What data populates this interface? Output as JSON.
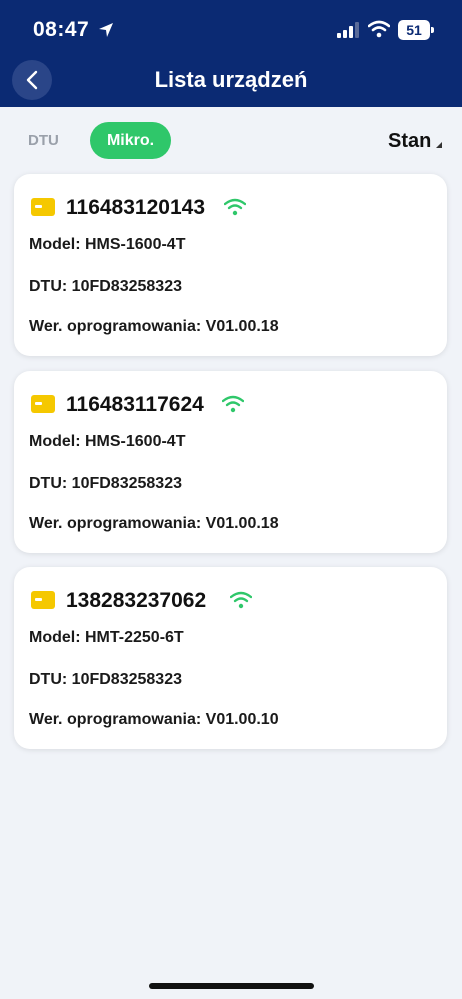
{
  "status_bar": {
    "time": "08:47",
    "battery": "51"
  },
  "header": {
    "title": "Lista urządzeń"
  },
  "tabs": {
    "dtu": "DTU",
    "mikro": "Mikro."
  },
  "sort": {
    "label": "Stan"
  },
  "devices": [
    {
      "serial": "116483120143",
      "model_label": "Model:",
      "model": "HMS-1600-4T",
      "dtu_label": "DTU:",
      "dtu": "10FD83258323",
      "fw_label": "Wer. oprogramowania:",
      "fw": "V01.00.18"
    },
    {
      "serial": "116483117624",
      "model_label": "Model:",
      "model": "HMS-1600-4T",
      "dtu_label": "DTU:",
      "dtu": "10FD83258323",
      "fw_label": "Wer. oprogramowania:",
      "fw": "V01.00.18"
    },
    {
      "serial": "138283237062",
      "model_label": "Model:",
      "model": "HMT-2250-6T",
      "dtu_label": "DTU:",
      "dtu": "10FD83258323",
      "fw_label": "Wer. oprogramowania:",
      "fw": "V01.00.10"
    }
  ],
  "colors": {
    "header_bg": "#0b2a73",
    "accent_green": "#2fc76a",
    "device_icon_yellow": "#f5c800",
    "page_bg": "#f0f3f8"
  },
  "icons": [
    "location-arrow-icon",
    "cellular-signal-icon",
    "wifi-icon",
    "battery-icon",
    "chevron-left-icon",
    "device-icon",
    "wifi-online-icon"
  ]
}
